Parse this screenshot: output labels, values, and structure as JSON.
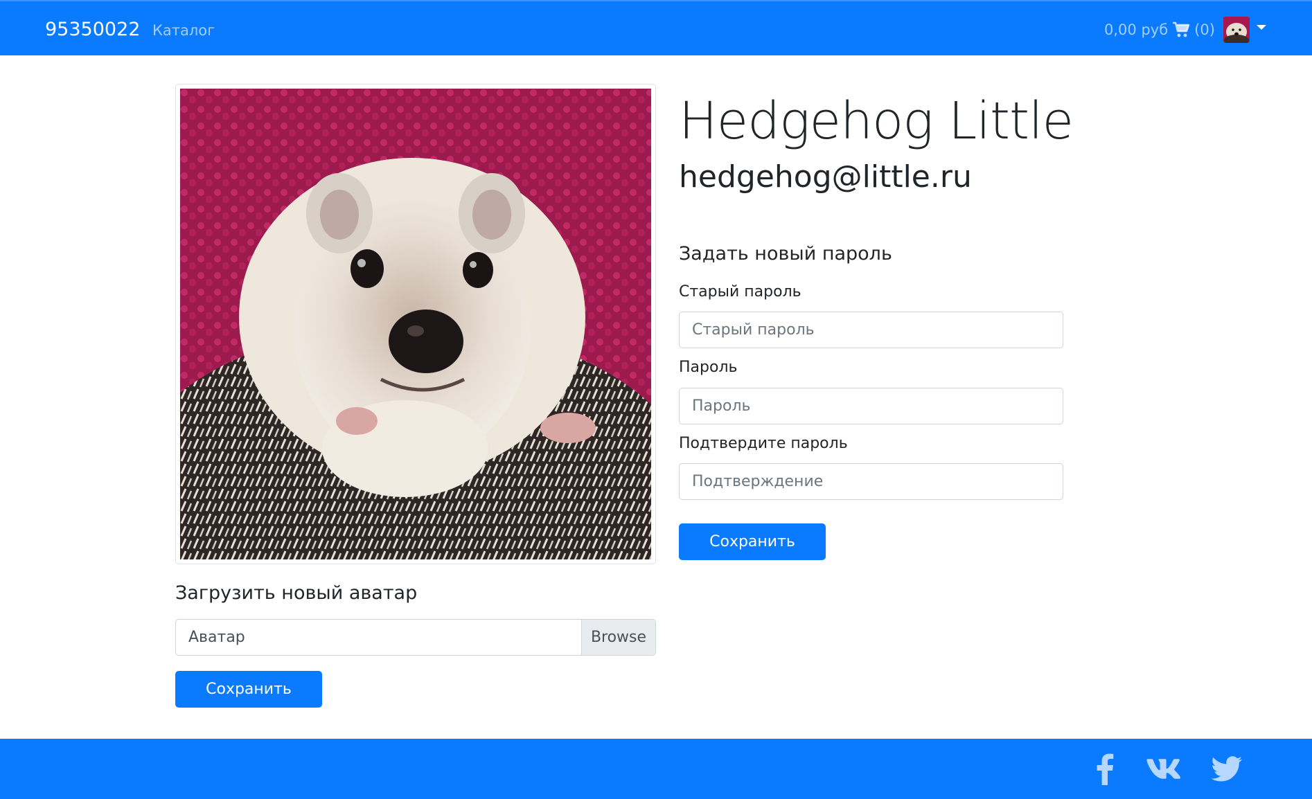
{
  "navbar": {
    "brand": "95350022",
    "catalog_link": "Каталог",
    "cart_total": "0,00 руб",
    "cart_count": "(0)",
    "cart_icon": "shopping-cart-icon",
    "avatar_icon": "user-avatar-thumbnail"
  },
  "profile": {
    "name": "Hedgehog Little",
    "email": "hedgehog@little.ru",
    "photo": "hedgehog-avatar-photo"
  },
  "avatar_form": {
    "title": "Загрузить новый аватар",
    "file_label": "Аватар",
    "browse_label": "Browse",
    "save_label": "Сохранить"
  },
  "password_form": {
    "title": "Задать новый пароль",
    "old_password_label": "Старый пароль",
    "old_password_placeholder": "Старый пароль",
    "password_label": "Пароль",
    "password_placeholder": "Пароль",
    "confirm_label": "Подтвердите пароль",
    "confirm_placeholder": "Подтверждение",
    "save_label": "Сохранить"
  },
  "footer": {
    "social": [
      "facebook-icon",
      "vk-icon",
      "twitter-icon"
    ]
  },
  "colors": {
    "primary": "#0a7bff",
    "text": "#212529",
    "muted": "#6c757d"
  }
}
